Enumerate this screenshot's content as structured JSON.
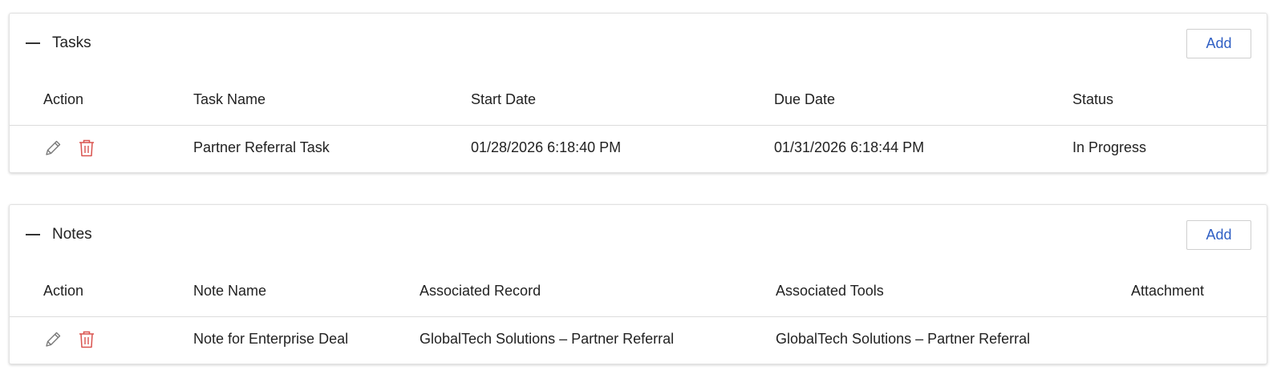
{
  "tasks": {
    "title": "Tasks",
    "add_label": "Add",
    "columns": [
      "Action",
      "Task Name",
      "Start Date",
      "Due Date",
      "Status"
    ],
    "rows": [
      {
        "task_name": "Partner Referral Task",
        "start_date": "01/28/2026 6:18:40 PM",
        "due_date": "01/31/2026 6:18:44 PM",
        "status": "In Progress"
      }
    ]
  },
  "notes": {
    "title": "Notes",
    "add_label": "Add",
    "columns": [
      "Action",
      "Note Name",
      "Associated Record",
      "Associated Tools",
      "Attachment"
    ],
    "rows": [
      {
        "note_name": "Note for Enterprise Deal",
        "associated_record": "GlobalTech Solutions – Partner Referral",
        "associated_tools": "GlobalTech Solutions – Partner Referral",
        "attachment": ""
      }
    ]
  },
  "icons": {
    "collapse": "minus-icon",
    "edit": "pencil-icon",
    "delete": "trash-icon"
  },
  "colors": {
    "link": "#2f5fc4",
    "delete": "#d9534f",
    "edit": "#777777"
  }
}
